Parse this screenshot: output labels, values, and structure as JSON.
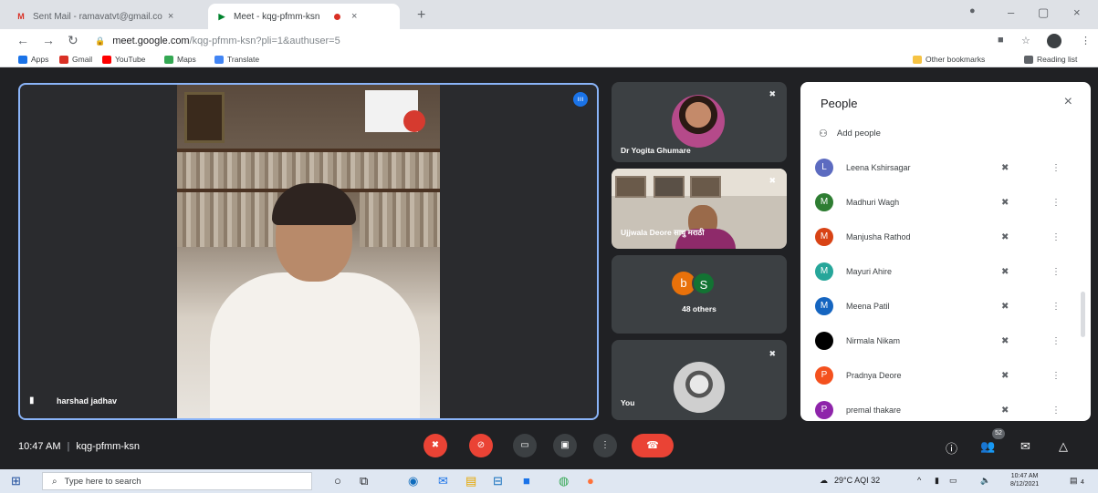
{
  "browser": {
    "tabs": [
      {
        "title": "Sent Mail - ramavatvt@gmail.co",
        "active": false,
        "icon": "gmail-icon"
      },
      {
        "title": "Meet - kqg-pfmm-ksn",
        "active": true,
        "icon": "meet-icon"
      }
    ],
    "url_host": "meet.google.com",
    "url_path": "/kqg-pfmm-ksn?pli=1&authuser=5",
    "bookmarks": [
      "Apps",
      "Gmail",
      "YouTube",
      "Maps",
      "Translate"
    ],
    "other_bookmarks": "Other bookmarks",
    "reading_list": "Reading list"
  },
  "meet": {
    "main_speaker": "harshad jadhav",
    "tiles": [
      {
        "name": "Dr Yogita Ghumare"
      },
      {
        "name": "Ujjwala Deore साधु मराठी"
      },
      {
        "name": "48 others",
        "avatars": [
          "b",
          "S"
        ]
      },
      {
        "name": "You"
      }
    ],
    "time": "10:47 AM",
    "separator": "|",
    "meeting_code": "kqg-pfmm-ksn",
    "participant_count": "52"
  },
  "people_panel": {
    "title": "People",
    "add_people": "Add people",
    "participants": [
      {
        "initial": "L",
        "name": "Leena Kshirsagar",
        "color": "#5c6bc0"
      },
      {
        "initial": "M",
        "name": "Madhuri Wagh",
        "color": "#2e7d32"
      },
      {
        "initial": "M",
        "name": "Manjusha Rathod",
        "color": "#d84315"
      },
      {
        "initial": "M",
        "name": "Mayuri Ahire",
        "color": "#26a69a"
      },
      {
        "initial": "M",
        "name": "Meena Patil",
        "color": "#1565c0"
      },
      {
        "initial": "",
        "name": "Nirmala Nikam",
        "color": "#000000"
      },
      {
        "initial": "P",
        "name": "Pradnya Deore",
        "color": "#f4511e"
      },
      {
        "initial": "P",
        "name": "premal thakare",
        "color": "#8e24aa"
      }
    ]
  },
  "taskbar": {
    "search_placeholder": "Type here to search",
    "weather": "29°C AQI 32",
    "time": "10:47 AM",
    "date": "8/12/2021",
    "notification_count": "4"
  },
  "colors": {
    "meet_bg": "#202124",
    "active_border": "#8ab4f8",
    "danger": "#ea4335"
  }
}
